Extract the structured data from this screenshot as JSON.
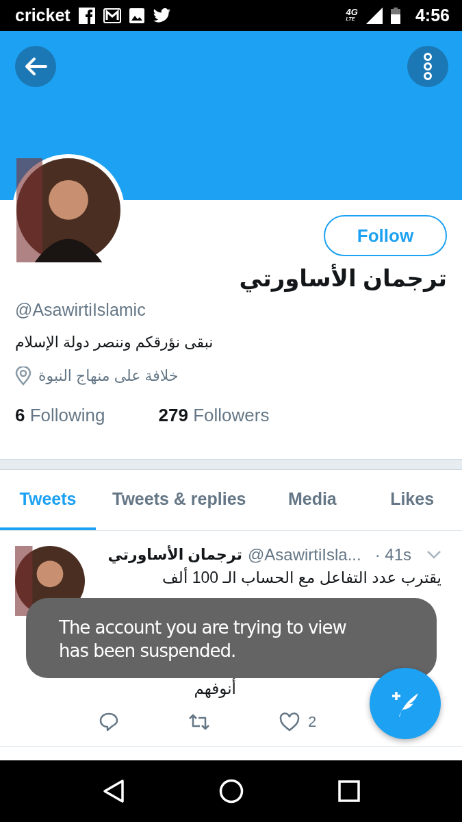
{
  "status_bar": {
    "carrier": "cricket",
    "network": "4G",
    "network_sub": "LTE",
    "time": "4:56"
  },
  "profile": {
    "name": "ترجمان الأساورتي",
    "handle": "@AsawirtiIslamic",
    "bio": "نبقى نؤرقكم وننصر دولة الإسلام",
    "location": "خلافة على منهاج النبوة",
    "following_count": "6",
    "following_label": "Following",
    "followers_count": "279",
    "followers_label": "Followers",
    "follow_button": "Follow"
  },
  "tabs": [
    {
      "label": "Tweets",
      "selected": true
    },
    {
      "label": "Tweets & replies",
      "selected": false
    },
    {
      "label": "Media",
      "selected": false
    },
    {
      "label": "Likes",
      "selected": false
    }
  ],
  "tweet": {
    "name": "ترجمان الأساورتي",
    "handle": "@AsawirtiIsla...",
    "time": "· 41s",
    "lines": [
      "يقترب عدد التفاعل مع الحساب الـ 100 ألف",
      "أنوفهم"
    ],
    "like_count": "2"
  },
  "toast": {
    "message": "The account you are trying to view has been suspended."
  }
}
